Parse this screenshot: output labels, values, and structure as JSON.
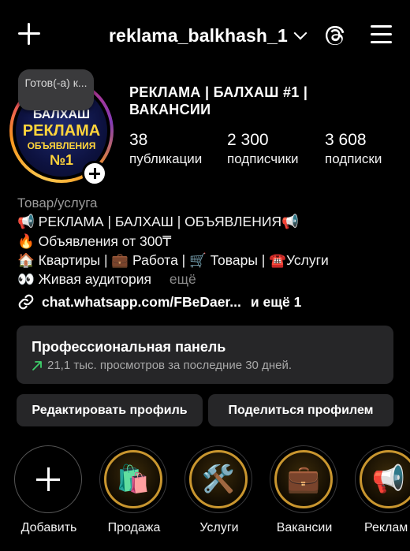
{
  "header": {
    "username": "reklama_balkhash_1",
    "create_icon": "plus-icon",
    "threads_icon": "threads-icon",
    "menu_icon": "hamburger-menu-icon"
  },
  "avatar": {
    "note": "Готов(-а) к...",
    "image_lines": [
      "БАЛХАШ",
      "РЕКЛАМА",
      "ОБЪЯВЛЕНИЯ",
      "№1"
    ]
  },
  "profile": {
    "name": "РЕКЛАМА | БАЛХАШ #1 | ВАКАНСИИ",
    "stats": [
      {
        "value": "38",
        "label": "публикации"
      },
      {
        "value": "2 300",
        "label": "подписчики"
      },
      {
        "value": "3 608",
        "label": "подписки"
      }
    ]
  },
  "bio": {
    "category": "Товар/услуга",
    "lines": [
      "📢 РЕКЛАМА | БАЛХАШ | ОБЪЯВЛЕНИЯ📢",
      "🔥 Объявления от 300₸",
      "🏠 Квартиры | 💼 Работа | 🛒 Товары | ☎️Услуги",
      "👀 Живая аудитория"
    ],
    "more_label": "ещё",
    "link": "chat.whatsapp.com/FBeDaer...",
    "link_more": "и ещё 1"
  },
  "dashboard": {
    "title": "Профессиональная панель",
    "subtitle": "21,1 тыс. просмотров за последние 30 дней.",
    "trend_color": "#3ecf6a"
  },
  "buttons": {
    "edit": "Редактировать профиль",
    "share": "Поделиться профилем"
  },
  "highlights": [
    {
      "label": "Добавить",
      "icon": "plus-icon"
    },
    {
      "label": "Продажа",
      "icon": "shopping-bags-icon"
    },
    {
      "label": "Услуги",
      "icon": "tools-icon"
    },
    {
      "label": "Вакансии",
      "icon": "briefcase-icon"
    },
    {
      "label": "Реклам",
      "icon": "megaphone-icon"
    }
  ]
}
